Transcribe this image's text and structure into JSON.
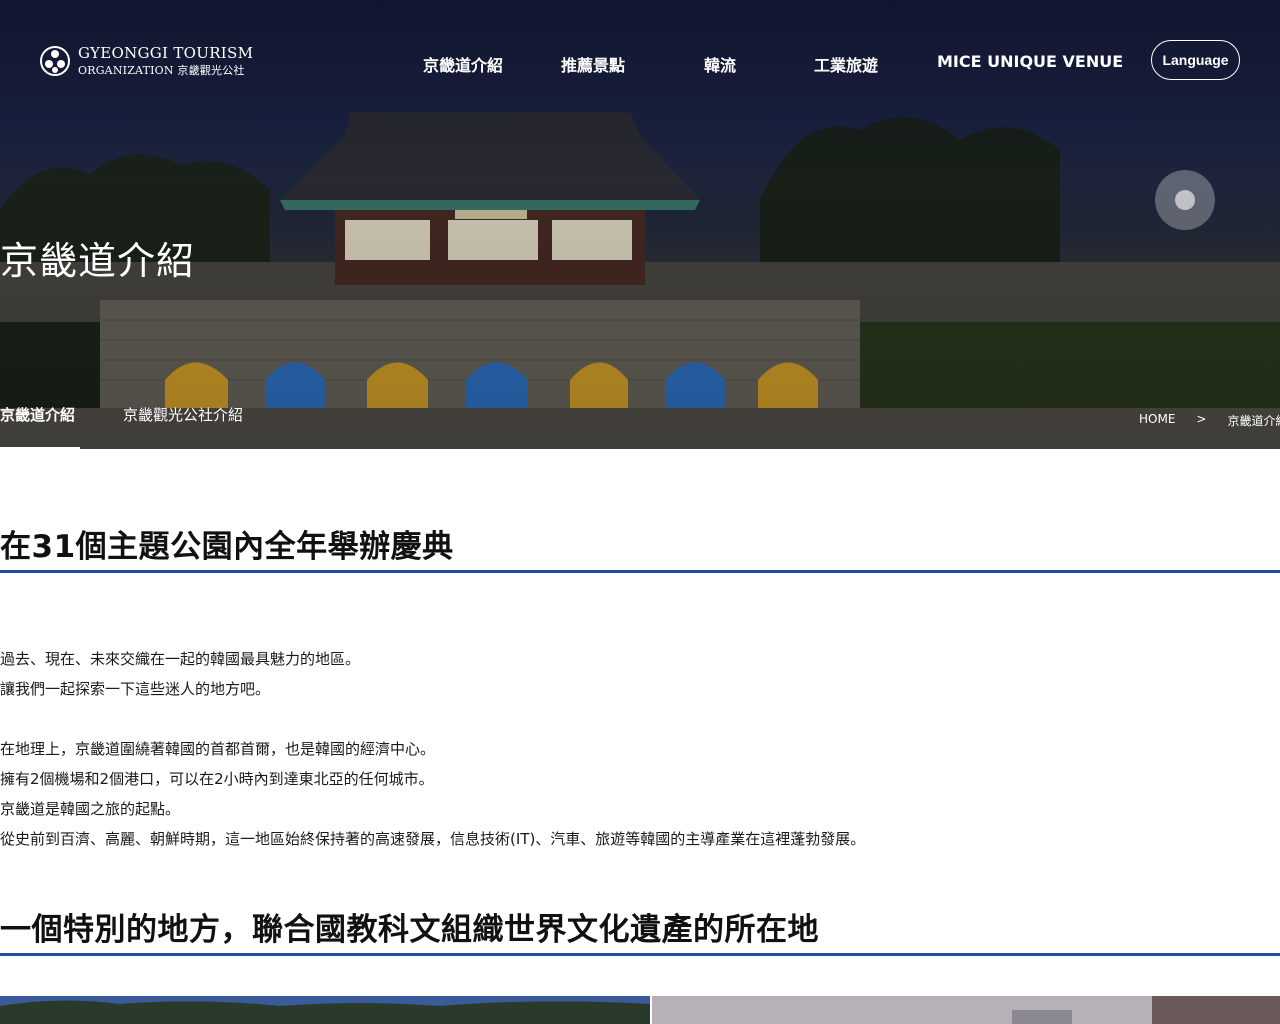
{
  "header": {
    "logo": {
      "line1": "GYEONGGI TOURISM",
      "line2": "ORGANIZATION 京畿觀光公社"
    },
    "nav": [
      {
        "label": "京畿道介紹"
      },
      {
        "label": "推薦景點"
      },
      {
        "label": "韓流"
      },
      {
        "label": "工業旅遊"
      },
      {
        "label": "MICE UNIQUE VENUE"
      }
    ],
    "language_button": "Language"
  },
  "hero": {
    "title": "京畿道介紹",
    "subtabs": [
      {
        "label": "京畿道介紹",
        "active": true
      },
      {
        "label": "京畿觀光公社介紹",
        "active": false
      }
    ],
    "breadcrumb": {
      "home": "HOME",
      "separator": ">",
      "current": "京畿道介紹"
    }
  },
  "content": {
    "section1": {
      "title": "在31個主題公園內全年舉辦慶典",
      "paragraph1": [
        "過去、現在、未來交織在一起的韓國最具魅力的地區。",
        "讓我們一起探索一下這些迷人的地方吧。"
      ],
      "paragraph2": [
        "在地理上，京畿道圍繞著韓國的首都首爾，也是韓國的經濟中心。",
        "擁有2個機場和2個港口，可以在2小時內到達東北亞的任何城市。",
        "京畿道是韓國之旅的起點。",
        "從史前到百濟、高麗、朝鮮時期，這一地區始終保持著的高速發展，信息技術(IT)、汽車、旅遊等韓國的主導產業在這裡蓬勃發展。"
      ]
    },
    "section2": {
      "title": "一個特別的地方，聯合國教科文組織世界文化遺產的所在地"
    }
  },
  "colors": {
    "accent_rule": "#1f4f9c",
    "hero_text": "#ffffff",
    "body_text": "#111111"
  }
}
